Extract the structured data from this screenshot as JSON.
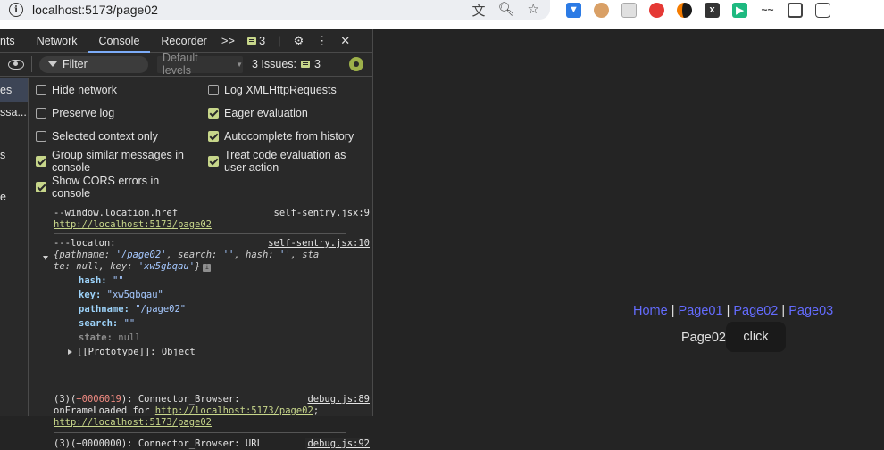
{
  "browser": {
    "url": "localhost:5173/page02"
  },
  "devtools": {
    "tabs": [
      {
        "label": "nts"
      },
      {
        "label": "Network"
      },
      {
        "label": "Console"
      },
      {
        "label": "Recorder"
      }
    ],
    "more_label": ">>",
    "issue_count": "3",
    "toolbar": {
      "filter_placeholder": "Filter",
      "levels_label": "Default levels",
      "issues_label": "3 Issues:",
      "issues_count": "3"
    },
    "sidebar": [
      "es",
      "ssa...",
      "s",
      "e"
    ],
    "settings": {
      "hide_network": "Hide network",
      "preserve_log": "Preserve log",
      "selected_context": "Selected context only",
      "group_similar": "Group similar messages in",
      "group_similar_2": "console",
      "show_cors": "Show CORS errors in",
      "show_cors_2": "console",
      "log_xhr": "Log XMLHttpRequests",
      "eager_eval": "Eager evaluation",
      "autocomplete": "Autocomplete from history",
      "treat_code": "Treat code evaluation as",
      "treat_code_2": "user action"
    },
    "console": {
      "log1_text": "--window.location.href",
      "log1_src": "self-sentry.jsx:9",
      "log1_link": "http://localhost:5173/page02",
      "log2_text": "---locaton:",
      "log2_src": "self-sentry.jsx:10",
      "obj_open": "{",
      "obj_pathname_k": "pathname:",
      "obj_pathname_v": "'/page02'",
      "obj_search_k": ", search:",
      "obj_search_v": "''",
      "obj_hash_k": ", hash:",
      "obj_hash_v": "''",
      "obj_state_k": ", sta",
      "obj_line2_a": "te: null, key:",
      "obj_key_v": "'xw5gbqau'",
      "obj_close": "}",
      "info_glyph": "i",
      "prop_hash_k": "hash:",
      "prop_hash_v": "\"\"",
      "prop_key_k": "key:",
      "prop_key_v": "\"xw5gbqau\"",
      "prop_pathname_k": "pathname:",
      "prop_pathname_v": "\"/page02\"",
      "prop_search_k": "search:",
      "prop_search_v": "\"\"",
      "prop_state_k": "state:",
      "prop_state_v": "null",
      "prototype": "[[Prototype]]: Object",
      "log3_prefix": "(3)(",
      "log3_time": "+0006019",
      "log3_rest": "): Connector_Browser:",
      "log3_src": "debug.js:89",
      "log3_line2": "onFrameLoaded for",
      "log3_link1": "http://localhost:5173/page02",
      "log3_sep": ";",
      "log3_link2": "http://localhost:5173/page02",
      "log4_text": "(3)(+0000000): Connector_Browser: URL",
      "log4_src": "debug.js:92"
    }
  },
  "page": {
    "nav": [
      "Home",
      "Page01",
      "Page02",
      "Page03"
    ],
    "nav_sep": "|",
    "label": "Page02",
    "button": "click",
    "colors": {
      "link": "#646cff",
      "background": "#242424",
      "button_bg": "#1a1a1a"
    }
  }
}
